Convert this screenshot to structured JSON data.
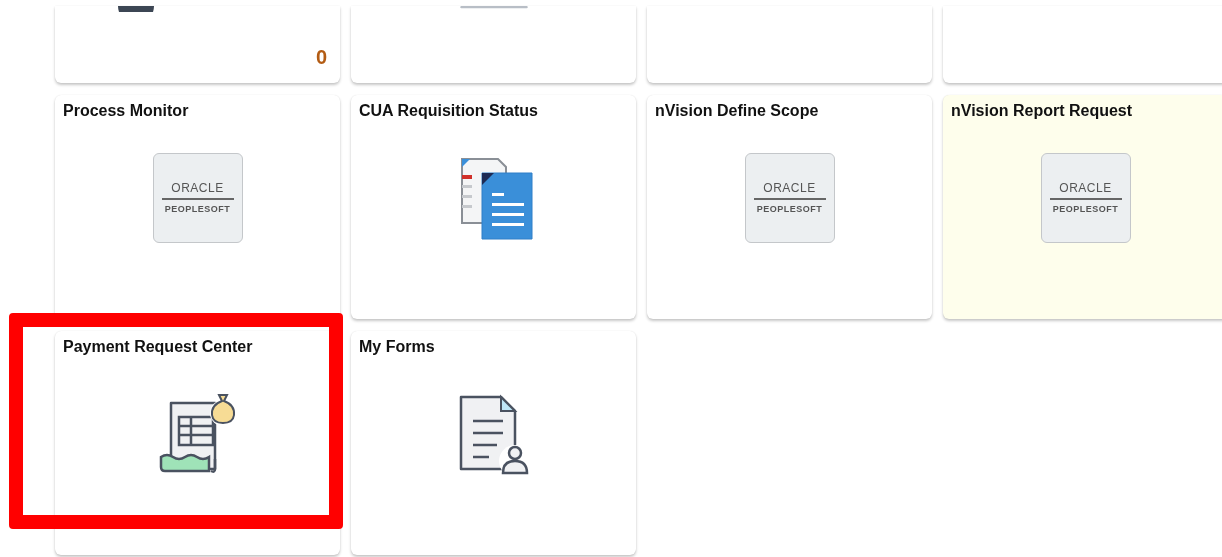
{
  "tiles": [
    {
      "kind": "circle",
      "count": "0",
      "tinted": false,
      "highlighted": false
    },
    {
      "kind": "bar",
      "tinted": false,
      "highlighted": false
    },
    {
      "kind": "blank",
      "tinted": false,
      "highlighted": false
    },
    {
      "kind": "blank",
      "tinted": false,
      "highlighted": false
    },
    {
      "title": "Process Monitor",
      "kind": "logo",
      "logo_top": "ORACLE",
      "logo_bottom": "PEOPLESOFT",
      "tinted": false,
      "highlighted": false
    },
    {
      "title": "CUA Requisition Status",
      "kind": "documents",
      "tinted": false,
      "highlighted": false
    },
    {
      "title": "nVision Define Scope",
      "kind": "logo",
      "logo_top": "ORACLE",
      "logo_bottom": "PEOPLESOFT",
      "tinted": false,
      "highlighted": false
    },
    {
      "title": "nVision Report Request",
      "kind": "logo",
      "logo_top": "ORACLE",
      "logo_bottom": "PEOPLESOFT",
      "tinted": true,
      "highlighted": false
    },
    {
      "title": "Payment Request Center",
      "kind": "payment",
      "tinted": false,
      "highlighted": true
    },
    {
      "title": "My Forms",
      "kind": "form",
      "tinted": false,
      "highlighted": false
    }
  ]
}
